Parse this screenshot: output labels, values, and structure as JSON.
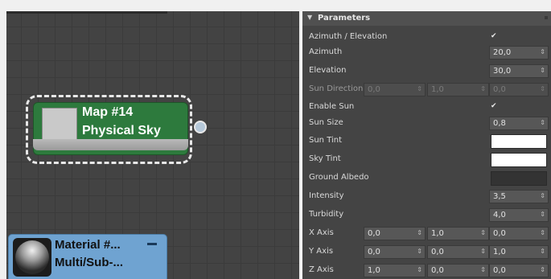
{
  "node_editor": {
    "map_node": {
      "line1": "Map #14",
      "line2": "Physical Sky"
    },
    "material_node": {
      "line1": "Material #...",
      "line2": "Multi/Sub-..."
    }
  },
  "parameters": {
    "title": "Parameters",
    "azimuth_elevation": {
      "label": "Azimuth / Elevation",
      "checked": true,
      "check_glyph": "✔"
    },
    "azimuth": {
      "label": "Azimuth",
      "value": "20,0"
    },
    "elevation": {
      "label": "Elevation",
      "value": "30,0"
    },
    "sun_direction": {
      "label": "Sun Direction",
      "x": "0,0",
      "y": "1,0",
      "z": "0,0"
    },
    "enable_sun": {
      "label": "Enable Sun",
      "checked": true,
      "check_glyph": "✔"
    },
    "sun_size": {
      "label": "Sun Size",
      "value": "0,8"
    },
    "sun_tint": {
      "label": "Sun Tint",
      "color": "#ffffff"
    },
    "sky_tint": {
      "label": "Sky Tint",
      "color": "#ffffff"
    },
    "ground_albedo": {
      "label": "Ground Albedo",
      "color": "#333333"
    },
    "intensity": {
      "label": "Intensity",
      "value": "3,5"
    },
    "turbidity": {
      "label": "Turbidity",
      "value": "4,0"
    },
    "x_axis": {
      "label": "X Axis",
      "x": "0,0",
      "y": "1,0",
      "z": "0,0"
    },
    "y_axis": {
      "label": "Y Axis",
      "x": "0,0",
      "y": "0,0",
      "z": "1,0"
    },
    "z_axis": {
      "label": "Z Axis",
      "x": "1,0",
      "y": "0,0",
      "z": "0,0"
    },
    "spinner_arrows": "⇕"
  },
  "colors": {
    "map_node_green": "#2d7a3d",
    "material_node_blue": "#6fa3d1",
    "panel_bg": "#444444",
    "editor_bg": "#434343"
  }
}
